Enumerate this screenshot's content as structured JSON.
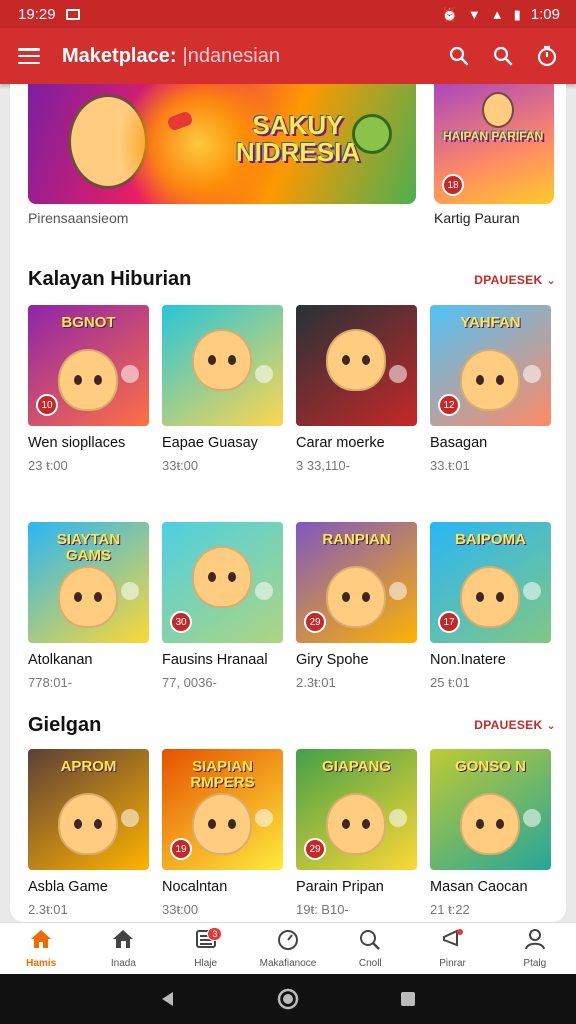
{
  "status_bar": {
    "time": "19:29",
    "battery": "1:09"
  },
  "app_bar": {
    "title": "Maketplace:",
    "subtitle": "|ndanesian"
  },
  "banners": [
    {
      "caption": "Pirensaansieom",
      "badge_text": "SAKUY NIDRESIA",
      "colors": [
        "#7b1fa2",
        "#ff9800"
      ]
    },
    {
      "caption": "Kartig Pauran",
      "badge_text": "HAIPAN PARIFAN",
      "colors": [
        "#ab47bc",
        "#ffca28"
      ]
    }
  ],
  "sections": [
    {
      "title": "Kalayan Hiburian",
      "see_more": "DPAUESEK",
      "items": [
        {
          "title": "Wen siopllaces",
          "meta": "23 ŧ:00",
          "badge": "10",
          "art": "BGNOT",
          "icon": "bear-game-art",
          "bg": [
            "#8e24aa",
            "#ff7043"
          ]
        },
        {
          "title": "Eapae Guasay",
          "meta": "33ŧ:00",
          "badge": "",
          "art": "",
          "icon": "boy-game-art",
          "bg": [
            "#26c6da",
            "#ffd54f"
          ]
        },
        {
          "title": "Carar moerke",
          "meta": "3 33,110-",
          "badge": "",
          "art": "",
          "icon": "bear-fighter-art",
          "bg": [
            "#263238",
            "#c62828"
          ]
        },
        {
          "title": "Basagan",
          "meta": "33.ŧ:01",
          "badge": "12",
          "art": "YAHFAN",
          "icon": "team-game-art",
          "bg": [
            "#4fc3f7",
            "#ff8a65"
          ]
        }
      ]
    },
    {
      "title": "",
      "see_more": "",
      "items": [
        {
          "title": "Atolkanan",
          "meta": "778:01-",
          "badge": "",
          "art": "SIAYTAN GAMS",
          "icon": "animals-game-art",
          "bg": [
            "#29b6f6",
            "#fdd835"
          ]
        },
        {
          "title": "Fausins Hranaal",
          "meta": "77, 0036-",
          "badge": "30",
          "art": "",
          "icon": "teddy-bear-art",
          "bg": [
            "#4dd0e1",
            "#aed581"
          ]
        },
        {
          "title": "Giry Spohe",
          "meta": "2.3ŧ:01",
          "badge": "29",
          "art": "RANPIAN",
          "icon": "runner-game-art",
          "bg": [
            "#7e57c2",
            "#ffb300"
          ]
        },
        {
          "title": "Non.Inatere",
          "meta": "25 ŧ:01",
          "badge": "17",
          "art": "BAIPOMA",
          "icon": "pets-game-art",
          "bg": [
            "#29b6f6",
            "#81c784"
          ]
        }
      ]
    },
    {
      "title": "Gielgan",
      "see_more": "DPAUESEK",
      "items": [
        {
          "title": "Asbla Game",
          "meta": "2.3ŧ:01",
          "badge": "",
          "art": "APROM",
          "icon": "heroes-game-art",
          "bg": [
            "#5d4037",
            "#ffb300"
          ]
        },
        {
          "title": "Nocalntan",
          "meta": "33ŧ:00",
          "badge": "19",
          "art": "SIAPIAN RMPERS",
          "icon": "battle-game-art",
          "bg": [
            "#e65100",
            "#ffeb3b"
          ]
        },
        {
          "title": "Parain Pripan",
          "meta": "19ŧ: B10-",
          "badge": "29",
          "art": "GIAPANG",
          "icon": "kids-game-art",
          "bg": [
            "#43a047",
            "#fdd835"
          ]
        },
        {
          "title": "Masan Caocan",
          "meta": "21 ŧ:22",
          "badge": "",
          "art": "GONSO N",
          "icon": "friends-game-art",
          "bg": [
            "#c0ca33",
            "#26a69a"
          ]
        }
      ]
    }
  ],
  "bottom_nav": [
    {
      "label": "Hamis",
      "icon": "home-icon",
      "active": true,
      "badge": ""
    },
    {
      "label": "Inada",
      "icon": "store-icon",
      "active": false,
      "badge": ""
    },
    {
      "label": "Hlaje",
      "icon": "list-icon",
      "active": false,
      "badge": "3"
    },
    {
      "label": "Makafianoce",
      "icon": "speedometer-icon",
      "active": false,
      "badge": ""
    },
    {
      "label": "Cnoll",
      "icon": "search-icon",
      "active": false,
      "badge": ""
    },
    {
      "label": "Pinrar",
      "icon": "megaphone-icon",
      "active": false,
      "badge": ""
    },
    {
      "label": "Ptalg",
      "icon": "person-icon",
      "active": false,
      "badge": ""
    }
  ]
}
